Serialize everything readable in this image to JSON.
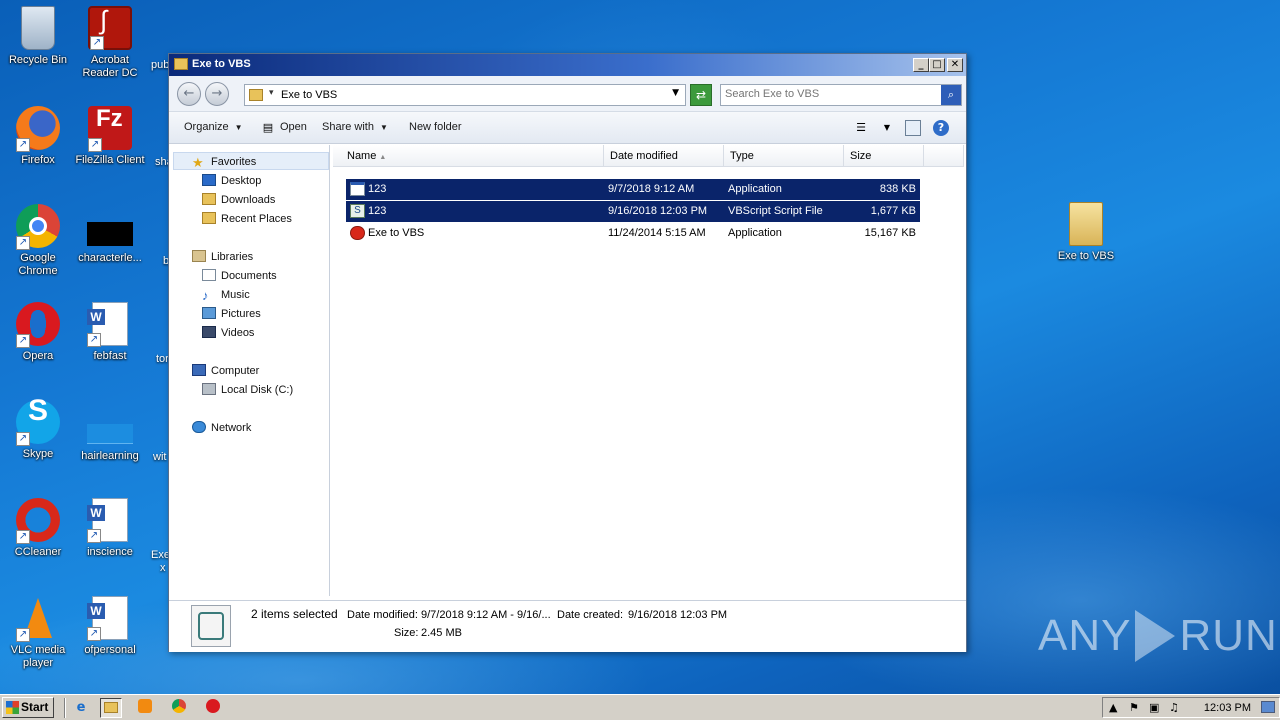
{
  "desktop": {
    "icons": [
      {
        "label": "Recycle Bin",
        "icon": "recycle-bin-icon"
      },
      {
        "label": "Acrobat\nReader DC",
        "icon": "acrobat-icon"
      },
      {
        "label": "Firefox",
        "icon": "firefox-icon"
      },
      {
        "label": "FileZilla Client",
        "icon": "filezilla-icon"
      },
      {
        "label": "Google\nChrome",
        "icon": "chrome-icon"
      },
      {
        "label": "characterle...",
        "icon": "black-file-icon"
      },
      {
        "label": "Opera",
        "icon": "opera-icon"
      },
      {
        "label": "febfast",
        "icon": "word-doc-icon"
      },
      {
        "label": "Skype",
        "icon": "skype-icon"
      },
      {
        "label": "hairlearning",
        "icon": "blank-file-icon"
      },
      {
        "label": "CCleaner",
        "icon": "ccleaner-icon"
      },
      {
        "label": "inscience",
        "icon": "word-doc-icon"
      },
      {
        "label": "VLC media\nplayer",
        "icon": "vlc-icon"
      },
      {
        "label": "ofpersonal",
        "icon": "word-doc-icon"
      },
      {
        "label": "Exe to VBS",
        "icon": "folder-icon"
      }
    ],
    "partial_labels": [
      "pub",
      "sha",
      "b",
      "tor",
      "wit",
      "Exe",
      "x"
    ]
  },
  "window": {
    "title": "Exe to VBS",
    "address_path": "Exe to VBS",
    "search_placeholder": "Search Exe to VBS",
    "toolbar": {
      "organize": "Organize",
      "open": "Open",
      "share_with": "Share with",
      "new_folder": "New folder"
    },
    "nav": {
      "favorites": "Favorites",
      "desktop": "Desktop",
      "downloads": "Downloads",
      "recent_places": "Recent Places",
      "libraries": "Libraries",
      "documents": "Documents",
      "music": "Music",
      "pictures": "Pictures",
      "videos": "Videos",
      "computer": "Computer",
      "local_disk": "Local Disk (C:)",
      "network": "Network"
    },
    "columns": {
      "name": "Name",
      "date_modified": "Date modified",
      "type": "Type",
      "size": "Size"
    },
    "files": [
      {
        "name": "123",
        "date": "9/7/2018 9:12 AM",
        "type": "Application",
        "size": "838 KB",
        "selected": true
      },
      {
        "name": "123",
        "date": "9/16/2018 12:03 PM",
        "type": "VBScript Script File",
        "size": "1,677 KB",
        "selected": true
      },
      {
        "name": "Exe to VBS",
        "date": "11/24/2014 5:15 AM",
        "type": "Application",
        "size": "15,167 KB",
        "selected": false
      }
    ],
    "details": {
      "summary": "2 items selected",
      "date_modified_label": "Date modified:",
      "date_modified_value": "9/7/2018 9:12 AM - 9/16/...",
      "date_created_label": "Date created:",
      "date_created_value": "9/16/2018 12:03 PM",
      "size_label": "Size:",
      "size_value": "2.45 MB"
    }
  },
  "taskbar": {
    "start_label": "Start",
    "clock": "12:03 PM"
  },
  "watermark": {
    "left": "ANY",
    "right": "RUN"
  },
  "colors": {
    "selection": "#0a246a",
    "titlebar": "#0b2a7a",
    "desktop": "#1579d4"
  }
}
